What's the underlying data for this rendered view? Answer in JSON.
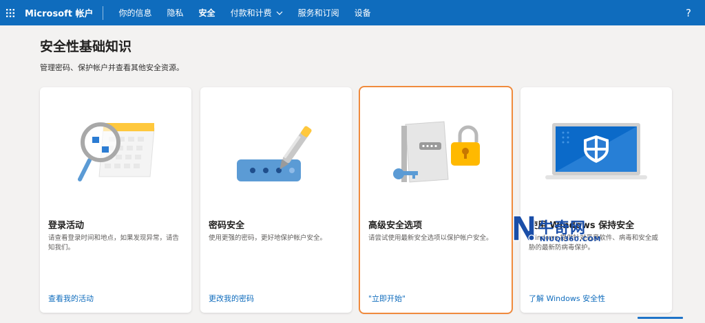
{
  "header": {
    "brand": "Microsoft 帐户",
    "nav": [
      {
        "label": "你的信息",
        "active": false
      },
      {
        "label": "隐私",
        "active": false
      },
      {
        "label": "安全",
        "active": true
      },
      {
        "label": "付款和计费",
        "active": false
      },
      {
        "label": "服务和订阅",
        "active": false
      },
      {
        "label": "设备",
        "active": false
      }
    ],
    "help": "?"
  },
  "page": {
    "title": "安全性基础知识",
    "subtitle": "管理密码、保护帐户并查看其他安全资源。"
  },
  "cards": [
    {
      "title": "登录活动",
      "description": "请查看登录时间和地点，如果发现异常，请告知我们。",
      "link": "查看我的活动"
    },
    {
      "title": "密码安全",
      "description": "使用更强的密码，更好地保护帐户安全。",
      "link": "更改我的密码"
    },
    {
      "title": "高级安全选项",
      "description": "请尝试使用最新安全选项以保护帐户安全。",
      "link": "\"立即开始\""
    },
    {
      "title": "使用 Windows 保持安全",
      "description": "Windows 提供针对恶意软件、病毒和安全威胁的最新防病毒保护。",
      "link": "了解 Windows 安全性"
    }
  ],
  "watermark": {
    "text": "牛奇网",
    "url": "NIUQI360.COM"
  },
  "colors": {
    "header": "#0f6cbd",
    "link": "#0f6cbd",
    "highlight": "#f08a3c"
  },
  "icons": [
    "app-launcher-icon",
    "chevron-down-icon",
    "help-icon",
    "magnifier-calendar-illustration",
    "password-pen-illustration",
    "security-lock-illustration",
    "windows-shield-laptop-illustration"
  ]
}
